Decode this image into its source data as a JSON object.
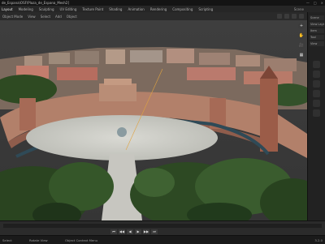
{
  "window": {
    "title": "de_Espana\\OSF\\Plaza_de_Espana_Mesh2]",
    "controls": [
      "—",
      "□",
      "×"
    ]
  },
  "menubar": {
    "items": [
      "Layout",
      "Modeling",
      "Sculpting",
      "UV Editing",
      "Texture Paint",
      "Shading",
      "Animation",
      "Rendering",
      "Compositing",
      "Scripting"
    ],
    "right_label": "Scene"
  },
  "viewport_header": {
    "items": [
      "Object Mode",
      "View",
      "Select",
      "Add",
      "Object"
    ]
  },
  "viewport": {
    "scene_description_colors": {
      "sky": "#3b3b3b",
      "stadium": "#b2876d",
      "plaza": "#cfd0cb",
      "trees": "#2f4a25"
    }
  },
  "navigation_gizmo": {
    "buttons": [
      "+",
      "✋",
      "🎥",
      "▦"
    ]
  },
  "sidebar": {
    "tabs": [
      "Scene",
      "View Layer",
      "Item",
      "Tool",
      "View"
    ]
  },
  "timeline": {
    "transport": [
      "⏮",
      "◀◀",
      "◀",
      "▶",
      "▶▶",
      "⏭"
    ]
  },
  "statusbar": {
    "left": "Select",
    "mid1": "Rotate View",
    "mid2": "Object Context Menu",
    "right": "3.2.0"
  }
}
